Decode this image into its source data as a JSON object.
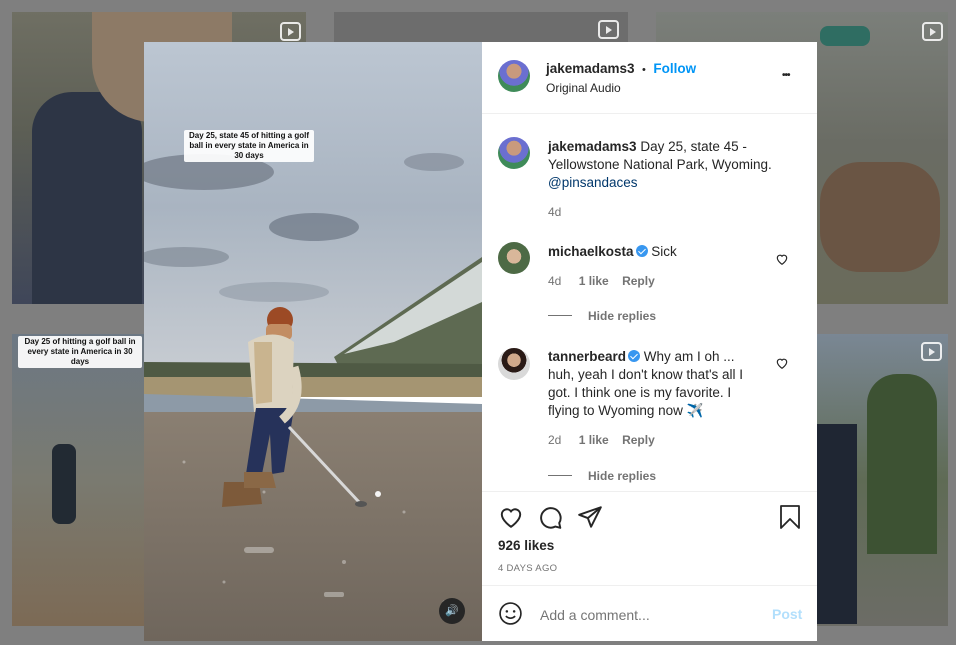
{
  "post": {
    "username": "jakemadams3",
    "separator": "•",
    "follow_label": "Follow",
    "audio_label": "Original Audio",
    "more_label": "•••",
    "overlay_caption": "Day 25, state 45 of hitting a golf ball in every state in America in 30 days",
    "mute_label": "🔊"
  },
  "caption": {
    "username": "jakemadams3",
    "text_line1": " Day 25, state 45 -",
    "text_line2": "Yellowstone National Park, Wyoming.",
    "mention": "@pinsandaces",
    "time": "4d"
  },
  "comments": [
    {
      "username": "michaelkosta",
      "text": " Sick",
      "time": "4d",
      "likes": "1 like",
      "reply_label": "Reply",
      "hide_replies": "Hide replies"
    },
    {
      "username": "tannerbeard",
      "text_line1": " Why am I oh ...",
      "text_line2": "huh, yeah I don't know that's all I",
      "text_line3": "got. I think one is my favorite. I",
      "text_line4": "flying to Wyoming now ✈️",
      "time": "2d",
      "likes": "1 like",
      "reply_label": "Reply",
      "hide_replies": "Hide replies"
    }
  ],
  "actions": {
    "likes_count": "926 likes",
    "posted_ago": "4 DAYS AGO"
  },
  "comment_box": {
    "placeholder": "Add a comment...",
    "post_label": "Post"
  },
  "background": {
    "tile_caption": "Day 25 of hitting a golf ball in every state in America in 30 days"
  }
}
